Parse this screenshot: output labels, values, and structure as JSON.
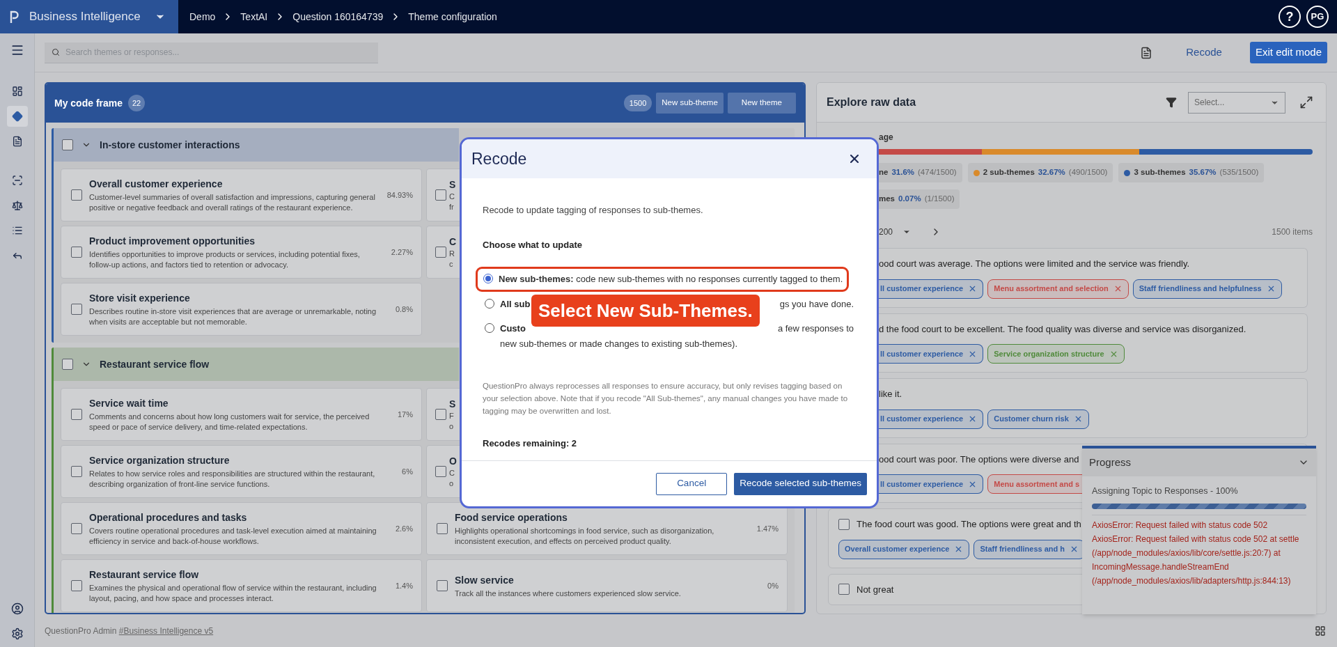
{
  "app": {
    "name": "Business Intelligence"
  },
  "breadcrumb": [
    "Demo",
    "TextAI",
    "Question 160164739",
    "Theme configuration"
  ],
  "help": {
    "label": "?"
  },
  "user": {
    "initials": "PG"
  },
  "sidebar": {
    "items": [
      {
        "selected": false
      },
      {
        "selected": true
      },
      {
        "selected": false
      },
      {
        "selected": false
      },
      {
        "selected": false
      },
      {
        "selected": false
      },
      {
        "selected": false
      }
    ]
  },
  "search": {
    "placeholder": "Search themes or responses..."
  },
  "toolbar": {
    "recode": "Recode",
    "exit": "Exit edit mode"
  },
  "code_frame": {
    "title": "My code frame",
    "count": "22",
    "total": "1500",
    "buttons": [
      "New sub-theme",
      "New theme"
    ],
    "themes": [
      {
        "name": "In-store customer interactions",
        "color": "#2d5ba3",
        "expanded": true,
        "checked": false,
        "subthemes": [
          {
            "kind": "full",
            "title": "Overall customer experience",
            "description": "Customer-level summaries of overall satisfaction and impressions, capturing general positive or negative feedback and overall ratings of the restaurant experience.",
            "percent": "84.93%",
            "checked": false
          },
          {
            "kind": "covered",
            "title": "S",
            "description_lines": [
              "C",
              "fr"
            ],
            "checked": false
          },
          {
            "kind": "full",
            "title": "Product improvement opportunities",
            "description": "Identifies opportunities to improve products or services, including potential fixes, follow-up actions, and factors tied to retention or advocacy.",
            "percent": "2.27%",
            "checked": false
          },
          {
            "kind": "covered",
            "title": "C",
            "description_lines": [
              "R",
              "c"
            ],
            "checked": false
          },
          {
            "kind": "full",
            "title": "Store visit experience",
            "description": "Describes routine in-store visit experiences that are average or unremarkable, noting when visits are acceptable but not memorable.",
            "percent": "0.8%",
            "checked": false
          }
        ]
      },
      {
        "name": "Restaurant service flow",
        "color": "#4f8a3a",
        "expanded": true,
        "checked": false,
        "subthemes": [
          {
            "kind": "full",
            "title": "Service wait time",
            "description": "Comments and concerns about how long customers wait for service, the perceived speed or pace of service delivery, and time-related expectations.",
            "percent": "17%",
            "checked": false
          },
          {
            "kind": "covered",
            "title": "S",
            "description_lines": [
              "F",
              "o"
            ],
            "checked": false
          },
          {
            "kind": "full",
            "title": "Service organization structure",
            "description": "Relates to how service roles and responsibilities are structured within the restaurant, describing organization of front-line service functions.",
            "percent": "6%",
            "checked": false
          },
          {
            "kind": "covered",
            "title": "O",
            "description_lines": [
              "C",
              "o"
            ],
            "checked": false
          },
          {
            "kind": "full",
            "title": "Operational procedures and tasks",
            "description": "Covers routine operational procedures and task-level execution aimed at maintaining efficiency in service and back-of-house workflows.",
            "percent": "2.6%",
            "checked": false
          },
          {
            "kind": "full",
            "title": "Food service operations",
            "description": "Highlights operational shortcomings in food service, such as disorganization, inconsistent execution, and effects on perceived product quality.",
            "percent": "1.47%",
            "checked": false
          },
          {
            "kind": "full",
            "title": "Restaurant service flow",
            "description": "Examines the physical and operational flow of service within the restaurant, including layout, pacing, and how space and processes interact.",
            "percent": "1.4%",
            "checked": false
          },
          {
            "kind": "full",
            "title": "Slow service",
            "description": "Track all the instances where customers experienced slow service.",
            "percent": "0%",
            "checked": false
          }
        ]
      }
    ]
  },
  "raw_data": {
    "title": "Explore raw data",
    "select_placeholder": "Select...",
    "coverage_label": "age",
    "coverage_bar": [
      {
        "color": "#c44a47"
      },
      {
        "color": "#d98a2b"
      },
      {
        "color": "#2d5ba3"
      }
    ],
    "legend": [
      {
        "label": "ne",
        "percent": "31.6%",
        "count": "(474/1500)"
      },
      {
        "label": "2 sub-themes",
        "percent": "32.67%",
        "count": "(490/1500)",
        "color": "#d98a2b"
      },
      {
        "label": "3 sub-themes",
        "percent": "35.67%",
        "count": "(535/1500)",
        "color": "#2d5ba3"
      },
      {
        "label": "mes",
        "percent": "0.07%",
        "count": "(1/1500)"
      }
    ],
    "page_size": "200",
    "items_count": "1500 items",
    "rows": [
      {
        "kind": "covered",
        "text": "ood court was average. The options were limited and the service was friendly.",
        "tags": [
          {
            "label": "ll customer experience",
            "color": "#2d5ba3"
          },
          {
            "label": "Menu assortment and selection",
            "color": "#c44a47"
          },
          {
            "label": "Staff friendliness and helpfulness",
            "color": "#2d5ba3"
          }
        ]
      },
      {
        "kind": "covered",
        "text": "d the food court to be excellent. The food quality was diverse and service was disorganized.",
        "tags": [
          {
            "label": "ll customer experience",
            "color": "#2d5ba3"
          },
          {
            "label": "Service organization structure",
            "color": "#4f8a3a"
          }
        ]
      },
      {
        "kind": "covered",
        "text": "like it.",
        "tags": [
          {
            "label": "ll customer experience",
            "color": "#2d5ba3"
          },
          {
            "label": "Customer churn risk",
            "color": "#2d5ba3"
          }
        ]
      },
      {
        "kind": "covered",
        "text": "ood court was poor. The options were diverse and",
        "tags": [
          {
            "label": "ll customer experience",
            "color": "#2d5ba3"
          },
          {
            "label": "Menu assortment and s",
            "color": "#c44a47"
          }
        ]
      },
      {
        "kind": "full",
        "checked": false,
        "text": "The food court was good. The options were great and th",
        "tags": [
          {
            "label": "Overall customer experience",
            "color": "#2d5ba3"
          },
          {
            "label": "Staff friendliness and h",
            "color": "#2d5ba3"
          }
        ]
      },
      {
        "kind": "full",
        "checked": false,
        "text": "Not great",
        "tags": []
      }
    ]
  },
  "progress": {
    "title": "Progress",
    "expanded": true,
    "task": "Assigning Topic to Responses - 100%",
    "level": 1,
    "errors": [
      "AxiosError: Request failed with status code 502",
      "AxiosError: Request failed with status code 502 at settle (/app/node_modules/axios/lib/core/settle.js:20:7) at IncomingMessage.handleStreamEnd (/app/node_modules/axios/lib/adapters/http.js:844:13)"
    ]
  },
  "footer": {
    "text": "QuestionPro Admin",
    "link": "#Business Intelligence v5"
  },
  "modal": {
    "title": "Recode",
    "intro": "Recode to update tagging of responses to sub-themes.",
    "section": "Choose what to update",
    "options": [
      {
        "kind": "full",
        "selected": true,
        "highlighted": true,
        "text": "**New sub-themes:** code new sub-themes with no responses currently tagged to them."
      },
      {
        "kind": "covered",
        "selected": false,
        "highlighted": false,
        "start": "All sub",
        "end": "gs you have done."
      },
      {
        "kind": "covered",
        "selected": false,
        "highlighted": false,
        "start": "Custo",
        "end": "a few responses to",
        "continuation": "new sub-themes or made changes to existing sub-themes)."
      }
    ],
    "note": "QuestionPro always reprocesses all responses to ensure accuracy, but only revises tagging based on your selection above. Note that if you recode \"All Sub-themes\", any manual changes you have made to tagging may be overwritten and lost.",
    "remaining": "Recodes remaining: 2",
    "cancel": "Cancel",
    "confirm": "Recode selected sub-themes"
  },
  "annotation": {
    "callout": "Select New Sub-Themes."
  }
}
